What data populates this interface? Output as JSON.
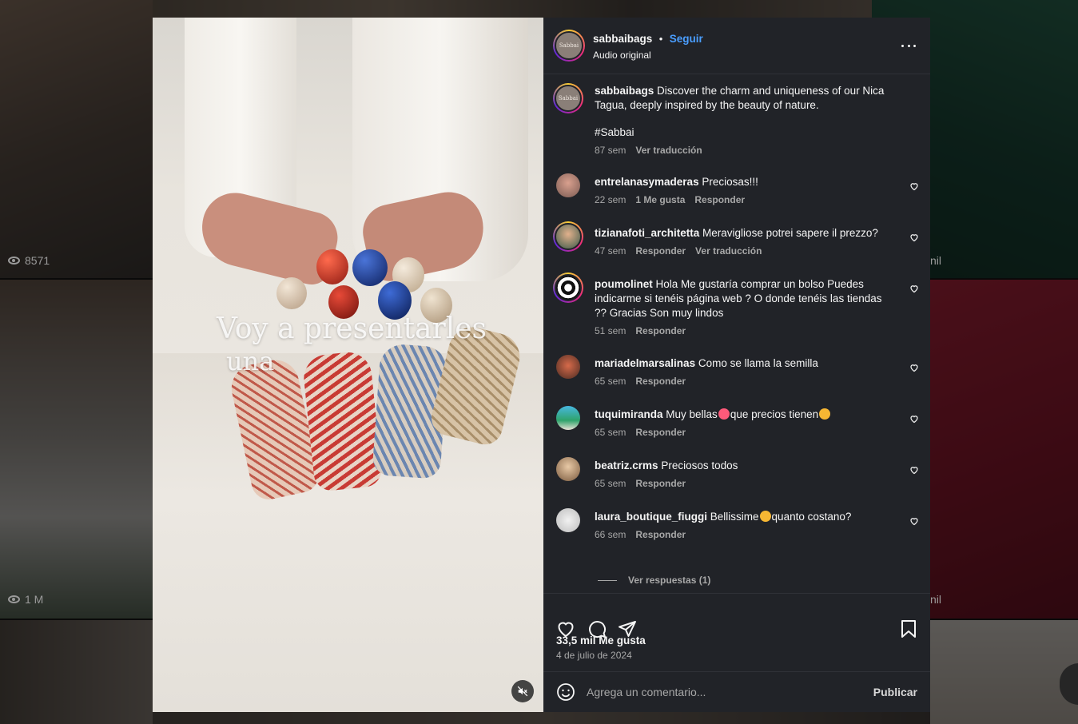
{
  "background": {
    "views_1": "8571",
    "views_2": "1 M",
    "partial_1": "nil",
    "partial_2": "nil"
  },
  "media": {
    "overlay_line1": "Voy a presentarles",
    "overlay_line2": "una",
    "mute_icon": "muted-speaker-icon"
  },
  "post": {
    "username": "sabbaibags",
    "separator": "•",
    "follow_label": "Seguir",
    "audio": "Audio original",
    "avatar_text": "Sabbai",
    "caption": {
      "username": "sabbaibags",
      "text": "Discover the charm and uniqueness of our Nica Tagua, deeply inspired by the beauty of nature.",
      "hashtag": "#Sabbai",
      "time": "87 sem",
      "translate": "Ver traducción"
    },
    "comments": [
      {
        "username": "entrelanasymaderas",
        "text": "Preciosas!!!",
        "time": "22 sem",
        "likes": "1 Me gusta",
        "reply": "Responder",
        "translate": ""
      },
      {
        "username": "tizianafoti_architetta",
        "text": "Meravigliose potrei sapere il prezzo?",
        "time": "47 sem",
        "likes": "",
        "reply": "Responder",
        "translate": "Ver traducción"
      },
      {
        "username": "poumolinet",
        "text": "Hola Me gustaría comprar un bolso Puedes indicarme si tenéis página web ? O donde tenéis las tiendas ?? Gracias Son muy lindos",
        "time": "51 sem",
        "likes": "",
        "reply": "Responder",
        "translate": ""
      },
      {
        "username": "mariadelmarsalinas",
        "text": "Como se llama la semilla",
        "time": "65 sem",
        "likes": "",
        "reply": "Responder",
        "translate": ""
      },
      {
        "username": "tuquimiranda",
        "text_a": "Muy bellas",
        "text_b": "que precios tienen",
        "time": "65 sem",
        "likes": "",
        "reply": "Responder",
        "translate": ""
      },
      {
        "username": "beatriz.crms",
        "text": "Preciosos todos",
        "time": "65 sem",
        "likes": "",
        "reply": "Responder",
        "translate": ""
      },
      {
        "username": "laura_boutique_fiuggi",
        "text_a": "Bellissime",
        "text_b": "quanto costano?",
        "time": "66 sem",
        "likes": "",
        "reply": "Responder",
        "translate": ""
      }
    ],
    "view_replies": "Ver respuestas (1)",
    "likes_count": "33,5 mil Me gusta",
    "date": "4 de julio de 2024",
    "comment_placeholder": "Agrega un comentario...",
    "publish_label": "Publicar",
    "more_icon": "more-options-icon",
    "icons": [
      "heart-icon",
      "comment-icon",
      "share-icon",
      "bookmark-icon",
      "emoji-icon"
    ]
  },
  "colors": {
    "panel_bg": "#212328",
    "link_blue": "#4a9eff",
    "muted_text": "#a8a8a8"
  }
}
